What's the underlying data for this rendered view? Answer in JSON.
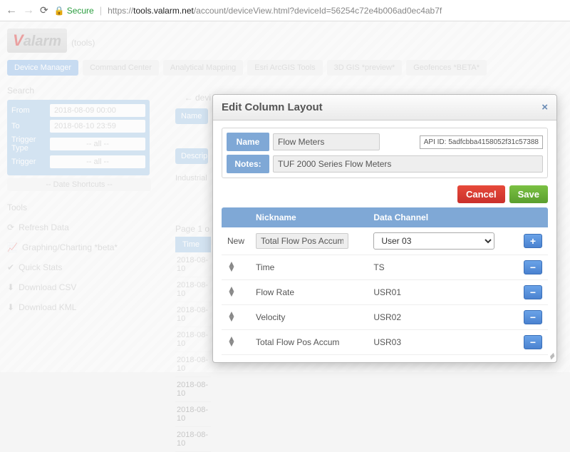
{
  "browser": {
    "secure_label": "Secure",
    "url_scheme": "https://",
    "url_host": "tools.valarm.net",
    "url_path": "/account/deviceView.html?deviceId=56254c72e4b006ad0ec4ab7f"
  },
  "backdrop": {
    "logo_v": "V",
    "logo_rest": "alarm",
    "logo_sub": "(tools)",
    "tabs": [
      "Device Manager",
      "Command Center",
      "Analytical Mapping",
      "Esri ArcGIS Tools",
      "3D GIS *preview*",
      "Geofences *BETA*"
    ],
    "search": "Search",
    "from_label": "From",
    "from_val": "2018-08-09 00:00",
    "to_label": "To",
    "to_val": "2018-08-10 23:59",
    "type_label": "Trigger Type",
    "type_val": "-- all --",
    "trigger_label": "Trigger",
    "trigger_val": "-- all --",
    "shortcuts": "-- Date Shortcuts --",
    "tools": "Tools",
    "links": [
      "Refresh Data",
      "Graphing/Charting *beta*",
      "Quick Stats",
      "Download CSV",
      "Download KML"
    ],
    "devi": "← devi",
    "name": "Name",
    "desc": "Descrip",
    "industrial": "Industrial",
    "pager": "Page 1 o",
    "time_h": "Time",
    "times": [
      "2018-08-10",
      "2018-08-10",
      "2018-08-10",
      "2018-08-10",
      "2018-08-10",
      "2018-08-10",
      "2018-08-10",
      "2018-08-10"
    ]
  },
  "modal": {
    "title": "Edit Column Layout",
    "name_label": "Name",
    "name_value": "Flow Meters",
    "api_label": "API ID:",
    "api_value": "5adfcbba4158052f31c57388",
    "notes_label": "Notes:",
    "notes_value": "TUF 2000 Series Flow Meters",
    "cancel": "Cancel",
    "save": "Save",
    "headers": {
      "c1": "",
      "c2": "Nickname",
      "c3": "Data Channel",
      "c4": ""
    },
    "new_label": "New",
    "new_nick": "Total Flow Pos Accum",
    "new_channel": "User 03",
    "rows": [
      {
        "nick": "Time",
        "chan": "TS"
      },
      {
        "nick": "Flow Rate",
        "chan": "USR01"
      },
      {
        "nick": "Velocity",
        "chan": "USR02"
      },
      {
        "nick": "Total Flow Pos Accum",
        "chan": "USR03"
      }
    ]
  }
}
